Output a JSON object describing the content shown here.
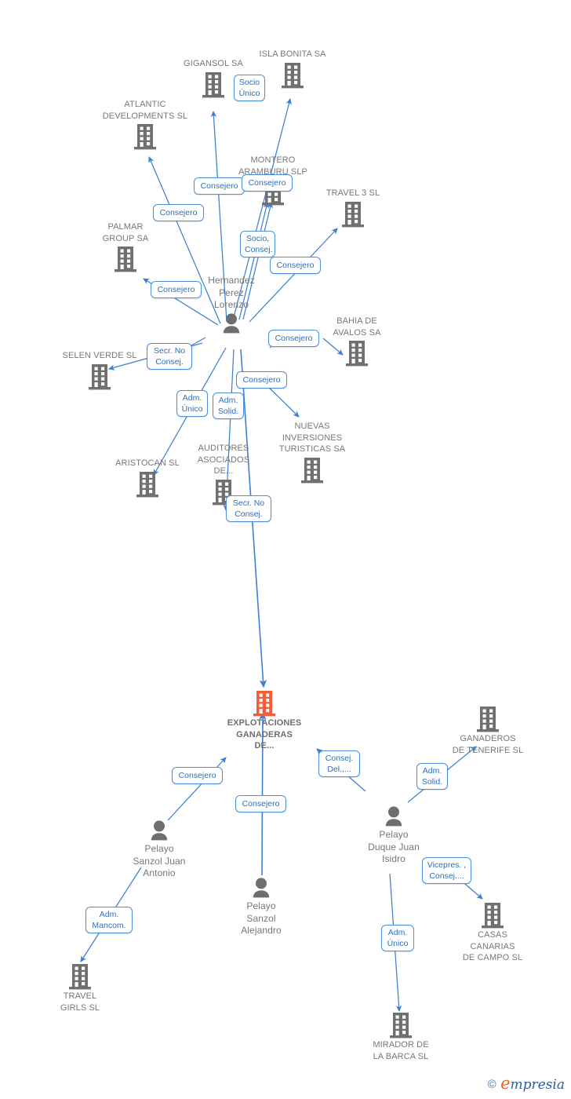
{
  "diagram": {
    "title": "EXPLOTACIONES GANADERAS DE... corporate relationship map",
    "colors": {
      "company_gray": "#707070",
      "company_highlight_orange": "#f95c34",
      "person_gray": "#6e6e6e",
      "edge_blue": "#3d7fd1",
      "chip_border": "#4a90d9",
      "chip_text": "#2f6fb5",
      "caption_text": "#77777a",
      "background": "#ffffff"
    }
  },
  "nodes": {
    "gigansol": {
      "label": "GIGANSOL SA",
      "type": "company"
    },
    "isla_bonita": {
      "label": "ISLA BONITA SA",
      "type": "company"
    },
    "atlantic": {
      "label": "ATLANTIC\nDEVELOPMENTS SL",
      "type": "company"
    },
    "montero": {
      "label": "MONTERO\nARAMBURU SLP",
      "type": "company"
    },
    "travel3": {
      "label": "TRAVEL 3 SL",
      "type": "company"
    },
    "palmar": {
      "label": "PALMAR\nGROUP SA",
      "type": "company"
    },
    "bahia": {
      "label": "BAHIA DE\nAVALOS SA",
      "type": "company"
    },
    "selen": {
      "label": "SELEN VERDE SL",
      "type": "company"
    },
    "nuevas": {
      "label": "NUEVAS\nINVERSIONES\nTURISTICAS SA",
      "type": "company"
    },
    "aristocan": {
      "label": "ARISTOCAN SL",
      "type": "company"
    },
    "auditores": {
      "label": "AUDITORES\nASOCIADOS\nDE...",
      "type": "company"
    },
    "hernandez": {
      "label": "Hernandez\nPerez\nLorenzo",
      "type": "person"
    },
    "explotaciones": {
      "label": "EXPLOTACIONES\nGANADERAS\nDE...",
      "type": "company-highlight"
    },
    "ganaderos_tenerife": {
      "label": "GANADEROS\nDE TENERIFE SL",
      "type": "company"
    },
    "pelayo_juan_antonio": {
      "label": "Pelayo\nSanzol Juan\nAntonio",
      "type": "person"
    },
    "pelayo_alejandro": {
      "label": "Pelayo\nSanzol\nAlejandro",
      "type": "person"
    },
    "pelayo_duque": {
      "label": "Pelayo\nDuque Juan\nIsidro",
      "type": "person"
    },
    "travel_girls": {
      "label": "TRAVEL\nGIRLS SL",
      "type": "company"
    },
    "casas_canarias": {
      "label": "CASAS\nCANARIAS\nDE CAMPO SL",
      "type": "company"
    },
    "mirador": {
      "label": "MIRADOR DE\nLA BARCA SL",
      "type": "company"
    }
  },
  "relations": [
    {
      "id": "r_socio_unico",
      "label": "Socio\nÚnico",
      "from": "hernandez",
      "to": "isla_bonita"
    },
    {
      "id": "r_gigansol",
      "label": "Consejero",
      "from": "hernandez",
      "to": "gigansol"
    },
    {
      "id": "r_montero",
      "label": "Consejero",
      "from": "hernandez",
      "to": "montero"
    },
    {
      "id": "r_atlantic",
      "label": "Consejero",
      "from": "hernandez",
      "to": "atlantic"
    },
    {
      "id": "r_palmar",
      "label": "Consejero",
      "from": "hernandez",
      "to": "palmar"
    },
    {
      "id": "r_socio_consej",
      "label": "Socio,\nConsej.",
      "from": "hernandez",
      "to": "montero"
    },
    {
      "id": "r_travel3",
      "label": "Consejero",
      "from": "hernandez",
      "to": "travel3"
    },
    {
      "id": "r_bahia",
      "label": "Consejero",
      "from": "hernandez",
      "to": "bahia"
    },
    {
      "id": "r_selen",
      "label": "Secr. No\nConsej.",
      "from": "hernandez",
      "to": "selen"
    },
    {
      "id": "r_nuevas",
      "label": "Consejero",
      "from": "hernandez",
      "to": "nuevas"
    },
    {
      "id": "r_aristocan",
      "label": "Adm.\nÚnico",
      "from": "hernandez",
      "to": "aristocan"
    },
    {
      "id": "r_auditores",
      "label": "Adm.\nSolid.",
      "from": "hernandez",
      "to": "auditores"
    },
    {
      "id": "r_explotaciones_hpl",
      "label": "Secr. No\nConsej.",
      "from": "hernandez",
      "to": "explotaciones"
    },
    {
      "id": "r_expl_juan_antonio",
      "label": "Consejero",
      "from": "pelayo_juan_antonio",
      "to": "explotaciones"
    },
    {
      "id": "r_expl_alejandro",
      "label": "Consejero",
      "from": "pelayo_alejandro",
      "to": "explotaciones"
    },
    {
      "id": "r_expl_duque",
      "label": "Consej.\nDel.,...",
      "from": "pelayo_duque",
      "to": "explotaciones"
    },
    {
      "id": "r_ganaderos",
      "label": "Adm.\nSolid.",
      "from": "pelayo_duque",
      "to": "ganaderos_tenerife"
    },
    {
      "id": "r_casas",
      "label": "Vicepres. ,\nConsej....",
      "from": "pelayo_duque",
      "to": "casas_canarias"
    },
    {
      "id": "r_mirador",
      "label": "Adm.\nÚnico",
      "from": "pelayo_duque",
      "to": "mirador"
    },
    {
      "id": "r_travel_girls",
      "label": "Adm.\nMancom.",
      "from": "pelayo_juan_antonio",
      "to": "travel_girls"
    }
  ],
  "watermark": {
    "copyright": "©",
    "brand_initial": "e",
    "brand_rest": "mpresia"
  }
}
